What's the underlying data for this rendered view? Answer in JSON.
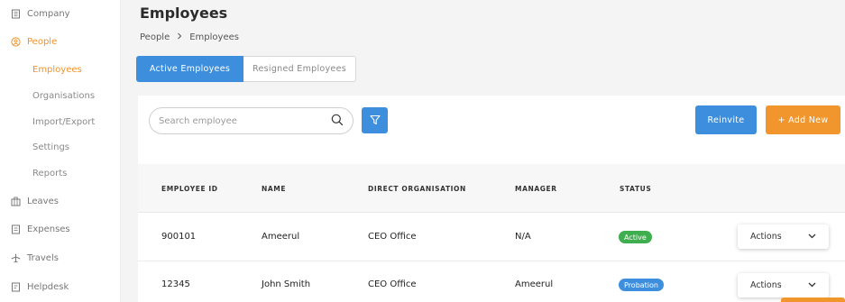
{
  "sidebar": {
    "items": [
      {
        "label": "Company",
        "icon": "building-icon"
      },
      {
        "label": "People",
        "icon": "people-icon"
      },
      {
        "label": "Leaves",
        "icon": "suitcase-icon"
      },
      {
        "label": "Expenses",
        "icon": "receipt-icon"
      },
      {
        "label": "Travels",
        "icon": "plane-icon"
      },
      {
        "label": "Helpdesk",
        "icon": "helpdesk-icon"
      }
    ],
    "people_subitems": [
      "Employees",
      "Organisations",
      "Import/Export",
      "Settings",
      "Reports"
    ]
  },
  "header": {
    "title": "Employees",
    "breadcrumb": [
      "People",
      "Employees"
    ]
  },
  "tabs": [
    {
      "label": "Active Employees"
    },
    {
      "label": "Resigned Employees"
    }
  ],
  "toolbar": {
    "search_placeholder": "Search employee",
    "reinvite_label": "Reinvite",
    "add_new_label": "+ Add New"
  },
  "table": {
    "columns": [
      "EMPLOYEE ID",
      "NAME",
      "DIRECT ORGANISATION",
      "MANAGER",
      "STATUS"
    ],
    "rows": [
      {
        "id": "900101",
        "name": "Ameerul",
        "org": "CEO Office",
        "manager": "N/A",
        "status": "Active",
        "actions": "Actions"
      },
      {
        "id": "12345",
        "name": "John Smith",
        "org": "CEO Office",
        "manager": "Ameerul",
        "status": "Probation",
        "actions": "Actions"
      }
    ]
  },
  "colors": {
    "accent_orange": "#f0932b",
    "primary_blue": "#3d8fde",
    "status_active": "#3fae4e",
    "status_probation": "#3d8fde"
  }
}
